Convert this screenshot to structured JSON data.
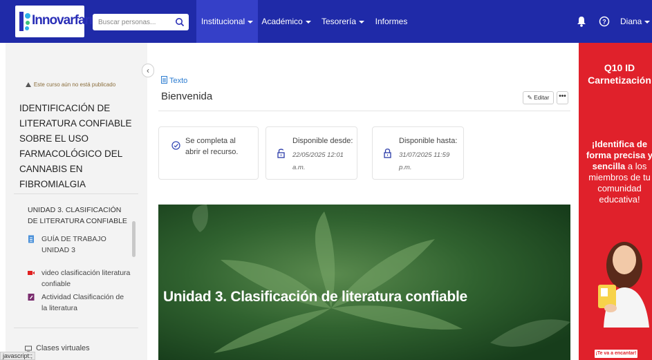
{
  "header": {
    "logo_text": "Innovarfarma",
    "search_placeholder": "Buscar personas...",
    "nav": [
      {
        "label": "Institucional",
        "dropdown": true,
        "active": true
      },
      {
        "label": "Académico",
        "dropdown": true,
        "active": false
      },
      {
        "label": "Tesorería",
        "dropdown": true,
        "active": false
      },
      {
        "label": "Informes",
        "dropdown": false,
        "active": false
      }
    ],
    "user_label": "Diana"
  },
  "sidebar": {
    "unpublished_notice": "Este curso aún no está publicado",
    "course_title": "IDENTIFICACIÓN DE LITERATURA CONFIABLE SOBRE EL USO FARMACOLÓGICO DEL CANNABIS EN FIBROMIALGIA",
    "unit_title": "UNIDAD 3. CLASIFICACIÓN DE LITERATURA CONFIABLE",
    "items": [
      {
        "label": "GUÍA DE TRABAJO UNIDAD 3",
        "icon": "document-icon"
      },
      {
        "label": "video clasificación literatura confiable",
        "icon": "video-icon"
      },
      {
        "label": "Actividad Clasificación de la literatura",
        "icon": "activity-icon"
      }
    ],
    "virtual_classes_label": "Clases virtuales"
  },
  "status_bar_text": "javascript:;",
  "main": {
    "resource_type": "Texto",
    "title": "Bienvenida",
    "edit_label": "Editar",
    "more_label": "•••",
    "completion": {
      "text": "Se completa al abrir el recurso."
    },
    "available_from": {
      "label": "Disponible desde:",
      "date": "22/05/2025 12:01 a.m."
    },
    "available_until": {
      "label": "Disponible hasta:",
      "date": "31/07/2025 11:59 p.m."
    },
    "banner_text": "Unidad 3. Clasificación de literatura confiable"
  },
  "ad": {
    "brand": "Q10 ID",
    "product": "Carnetización",
    "msg_bold": "¡Identifica de forma precisa y sencilla",
    "msg_rest": "a los miembros de tu comunidad educativa!",
    "cta": "¡Te va a encantar!"
  },
  "colors": {
    "navbar": "#1f2aa8",
    "nav_active": "#3540c8",
    "sidebar_bg": "#f3f3f3",
    "link": "#2a7bd0",
    "ad_red": "#e0212b",
    "banner_green": "#1f4a22"
  }
}
